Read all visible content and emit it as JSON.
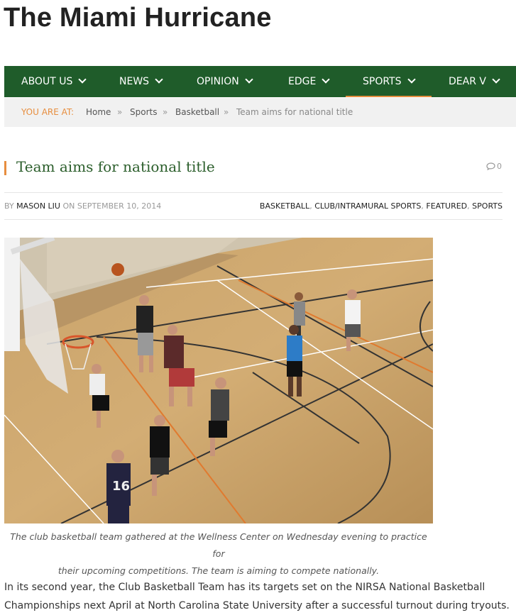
{
  "site": {
    "title": "The Miami Hurricane"
  },
  "nav": {
    "items": [
      {
        "label": "ABOUT US"
      },
      {
        "label": "NEWS"
      },
      {
        "label": "OPINION"
      },
      {
        "label": "EDGE"
      },
      {
        "label": "SPORTS",
        "active": true
      },
      {
        "label": "DEAR V"
      }
    ]
  },
  "breadcrumb": {
    "label": "YOU ARE AT:",
    "items": [
      "Home",
      "Sports",
      "Basketball"
    ],
    "separator": "»",
    "current": "Team aims for national title"
  },
  "post": {
    "title": "Team aims for national title",
    "comments_count": "0",
    "meta": {
      "by": "BY",
      "author": "MASON LIU",
      "on": "ON",
      "date": "SEPTEMBER 10, 2014",
      "categories": [
        "BASKETBALL",
        "CLUB/INTRAMURAL SPORTS",
        "FEATURED",
        "SPORTS"
      ]
    },
    "image_caption_line1": "The club basketball team gathered at the Wellness Center on Wednesday evening to practice for",
    "image_caption_line2": "their upcoming competitions. The team is aiming to compete nationally.",
    "body_line1": "In its second year, the Club Basketball Team has its targets set on the NIRSA National Basketball",
    "body_line2": "Championships next April at North Carolina State University after a successful turnout during tryouts."
  },
  "colors": {
    "nav_bg": "#1f5c2a",
    "accent": "#e78e3f",
    "title_green": "#2b5e2b"
  }
}
